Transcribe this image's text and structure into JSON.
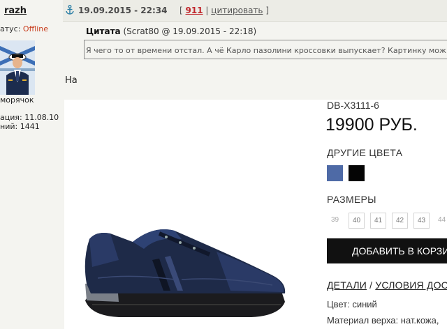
{
  "profile": {
    "username": "razh",
    "status_label": "атус: ",
    "status_value": "Offline",
    "rank": "морячок",
    "registered": "ация: 11.08.10",
    "messages": "ний: 1441"
  },
  "post": {
    "anchor_icon": "anchor-icon",
    "date": "19.09.2015 - 22:34",
    "open_bracket": "[",
    "post_number": "911",
    "separator": "|",
    "quote_link": "цитировать",
    "close_bracket": "]"
  },
  "quote": {
    "label": "Цитата",
    "meta": "(Scrat80 @ 19.09.2015 - 22:18)",
    "text": "Я чего то от времени отстал. А чё Карло пазолини кроссовки выпускает? Картинку мож кто"
  },
  "reply_text": "На",
  "product": {
    "sku": "DB-X3111-6",
    "price": "19900 РУБ.",
    "other_colors_title": "ДРУГИЕ ЦВЕТА",
    "swatches": [
      "#4e6aa6",
      "#050505"
    ],
    "sizes_title": "РАЗМЕРЫ",
    "sizes": [
      "39",
      "40",
      "41",
      "42",
      "43",
      "44"
    ],
    "add_to_cart": "ДОБАВИТЬ В КОРЗИН",
    "details_link": "ДЕТАЛИ",
    "details_sep": " / ",
    "conditions_link": "УСЛОВИЯ ДОС",
    "color_line": "Цвет: синий",
    "material_line": "Материал верха: нат.кожа,"
  }
}
